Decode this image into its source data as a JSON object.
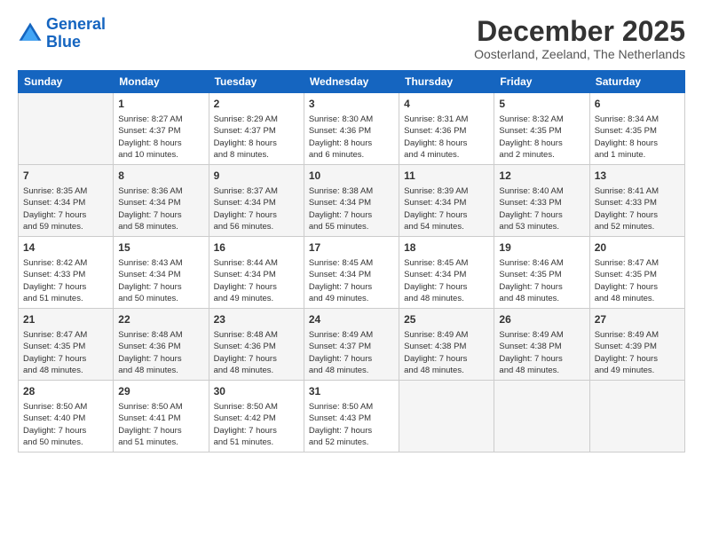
{
  "logo": {
    "line1": "General",
    "line2": "Blue"
  },
  "title": "December 2025",
  "subtitle": "Oosterland, Zeeland, The Netherlands",
  "weekdays": [
    "Sunday",
    "Monday",
    "Tuesday",
    "Wednesday",
    "Thursday",
    "Friday",
    "Saturday"
  ],
  "weeks": [
    [
      {
        "day": "",
        "info": ""
      },
      {
        "day": "1",
        "info": "Sunrise: 8:27 AM\nSunset: 4:37 PM\nDaylight: 8 hours\nand 10 minutes."
      },
      {
        "day": "2",
        "info": "Sunrise: 8:29 AM\nSunset: 4:37 PM\nDaylight: 8 hours\nand 8 minutes."
      },
      {
        "day": "3",
        "info": "Sunrise: 8:30 AM\nSunset: 4:36 PM\nDaylight: 8 hours\nand 6 minutes."
      },
      {
        "day": "4",
        "info": "Sunrise: 8:31 AM\nSunset: 4:36 PM\nDaylight: 8 hours\nand 4 minutes."
      },
      {
        "day": "5",
        "info": "Sunrise: 8:32 AM\nSunset: 4:35 PM\nDaylight: 8 hours\nand 2 minutes."
      },
      {
        "day": "6",
        "info": "Sunrise: 8:34 AM\nSunset: 4:35 PM\nDaylight: 8 hours\nand 1 minute."
      }
    ],
    [
      {
        "day": "7",
        "info": "Sunrise: 8:35 AM\nSunset: 4:34 PM\nDaylight: 7 hours\nand 59 minutes."
      },
      {
        "day": "8",
        "info": "Sunrise: 8:36 AM\nSunset: 4:34 PM\nDaylight: 7 hours\nand 58 minutes."
      },
      {
        "day": "9",
        "info": "Sunrise: 8:37 AM\nSunset: 4:34 PM\nDaylight: 7 hours\nand 56 minutes."
      },
      {
        "day": "10",
        "info": "Sunrise: 8:38 AM\nSunset: 4:34 PM\nDaylight: 7 hours\nand 55 minutes."
      },
      {
        "day": "11",
        "info": "Sunrise: 8:39 AM\nSunset: 4:34 PM\nDaylight: 7 hours\nand 54 minutes."
      },
      {
        "day": "12",
        "info": "Sunrise: 8:40 AM\nSunset: 4:33 PM\nDaylight: 7 hours\nand 53 minutes."
      },
      {
        "day": "13",
        "info": "Sunrise: 8:41 AM\nSunset: 4:33 PM\nDaylight: 7 hours\nand 52 minutes."
      }
    ],
    [
      {
        "day": "14",
        "info": "Sunrise: 8:42 AM\nSunset: 4:33 PM\nDaylight: 7 hours\nand 51 minutes."
      },
      {
        "day": "15",
        "info": "Sunrise: 8:43 AM\nSunset: 4:34 PM\nDaylight: 7 hours\nand 50 minutes."
      },
      {
        "day": "16",
        "info": "Sunrise: 8:44 AM\nSunset: 4:34 PM\nDaylight: 7 hours\nand 49 minutes."
      },
      {
        "day": "17",
        "info": "Sunrise: 8:45 AM\nSunset: 4:34 PM\nDaylight: 7 hours\nand 49 minutes."
      },
      {
        "day": "18",
        "info": "Sunrise: 8:45 AM\nSunset: 4:34 PM\nDaylight: 7 hours\nand 48 minutes."
      },
      {
        "day": "19",
        "info": "Sunrise: 8:46 AM\nSunset: 4:35 PM\nDaylight: 7 hours\nand 48 minutes."
      },
      {
        "day": "20",
        "info": "Sunrise: 8:47 AM\nSunset: 4:35 PM\nDaylight: 7 hours\nand 48 minutes."
      }
    ],
    [
      {
        "day": "21",
        "info": "Sunrise: 8:47 AM\nSunset: 4:35 PM\nDaylight: 7 hours\nand 48 minutes."
      },
      {
        "day": "22",
        "info": "Sunrise: 8:48 AM\nSunset: 4:36 PM\nDaylight: 7 hours\nand 48 minutes."
      },
      {
        "day": "23",
        "info": "Sunrise: 8:48 AM\nSunset: 4:36 PM\nDaylight: 7 hours\nand 48 minutes."
      },
      {
        "day": "24",
        "info": "Sunrise: 8:49 AM\nSunset: 4:37 PM\nDaylight: 7 hours\nand 48 minutes."
      },
      {
        "day": "25",
        "info": "Sunrise: 8:49 AM\nSunset: 4:38 PM\nDaylight: 7 hours\nand 48 minutes."
      },
      {
        "day": "26",
        "info": "Sunrise: 8:49 AM\nSunset: 4:38 PM\nDaylight: 7 hours\nand 48 minutes."
      },
      {
        "day": "27",
        "info": "Sunrise: 8:49 AM\nSunset: 4:39 PM\nDaylight: 7 hours\nand 49 minutes."
      }
    ],
    [
      {
        "day": "28",
        "info": "Sunrise: 8:50 AM\nSunset: 4:40 PM\nDaylight: 7 hours\nand 50 minutes."
      },
      {
        "day": "29",
        "info": "Sunrise: 8:50 AM\nSunset: 4:41 PM\nDaylight: 7 hours\nand 51 minutes."
      },
      {
        "day": "30",
        "info": "Sunrise: 8:50 AM\nSunset: 4:42 PM\nDaylight: 7 hours\nand 51 minutes."
      },
      {
        "day": "31",
        "info": "Sunrise: 8:50 AM\nSunset: 4:43 PM\nDaylight: 7 hours\nand 52 minutes."
      },
      {
        "day": "",
        "info": ""
      },
      {
        "day": "",
        "info": ""
      },
      {
        "day": "",
        "info": ""
      }
    ]
  ]
}
